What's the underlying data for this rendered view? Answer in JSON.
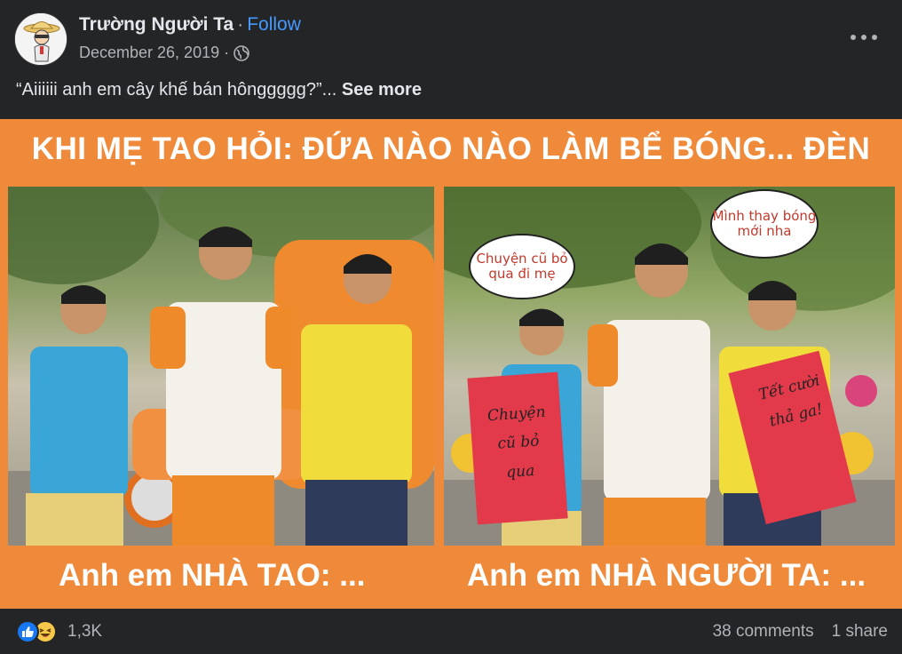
{
  "post": {
    "author": "Trường Người Ta",
    "separator": "·",
    "follow_label": "Follow",
    "date": "December 26, 2019",
    "audience_icon": "globe-icon",
    "more_icon": "more-options-icon",
    "caption_text": "“Aiiiiii anh em cây khế bán hônggggg?”...",
    "see_more_label": "See more"
  },
  "meme": {
    "title": "KHI MẸ TAO HỎI: ĐỨA NÀO NÀO LÀM BỂ BÓNG... ĐÈN",
    "left_caption": "Anh em NHÀ TAO: ...",
    "right_caption": "Anh em NHÀ NGƯỜI TA: ...",
    "bubble_left": "Chuyện cũ bỏ qua đi mẹ",
    "bubble_right": "Mình thay bóng mới nha",
    "sign_left": "Chuyện cũ bỏ qua",
    "sign_right": "Tết cười thả ga!",
    "background_color": "#ef8a3a"
  },
  "footer": {
    "reaction_icons": [
      "like-reaction-icon",
      "haha-reaction-icon"
    ],
    "reaction_count": "1,3K",
    "comments": "38 comments",
    "shares": "1 share"
  },
  "colors": {
    "background": "#242526",
    "link": "#4599ff",
    "secondary_text": "#b0b3b8",
    "primary_text": "#e4e6eb",
    "like_blue": "#1877f2",
    "haha_yellow": "#f7c94b"
  }
}
